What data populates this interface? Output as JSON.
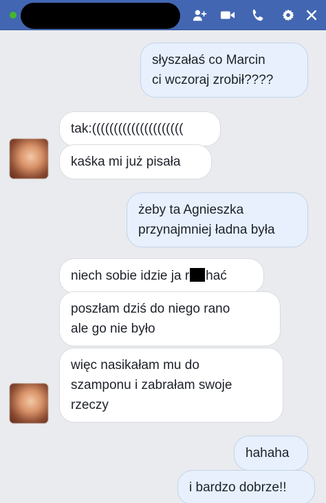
{
  "header": {
    "icons": [
      "add-person-icon",
      "video-call-icon",
      "phone-icon",
      "gear-icon",
      "close-icon"
    ],
    "colors": {
      "bar": "#4266b2",
      "online": "#42b72a"
    }
  },
  "messages": [
    {
      "dir": "out",
      "lines": [
        "słyszałaś co Marcin",
        "ci wczoraj zrobił????"
      ]
    },
    {
      "dir": "in",
      "lines": [
        "tak:((((((((((((((((((((("
      ]
    },
    {
      "dir": "in",
      "lines": [
        "kaśka mi już pisała"
      ]
    },
    {
      "dir": "out",
      "lines": [
        "żeby ta Agnieszka",
        "przynajmniej ładna była"
      ]
    },
    {
      "dir": "in",
      "prefix": "niech sobie idzie ja r",
      "suffix": "hać"
    },
    {
      "dir": "in",
      "lines": [
        "poszłam dziś do niego rano",
        "ale go nie było"
      ]
    },
    {
      "dir": "in",
      "lines": [
        "więc nasikałam mu do",
        "szamponu i zabrałam swoje",
        "rzeczy"
      ]
    },
    {
      "dir": "out",
      "lines": [
        "hahaha"
      ]
    },
    {
      "dir": "out",
      "lines": [
        "i bardzo dobrze!!"
      ]
    }
  ]
}
